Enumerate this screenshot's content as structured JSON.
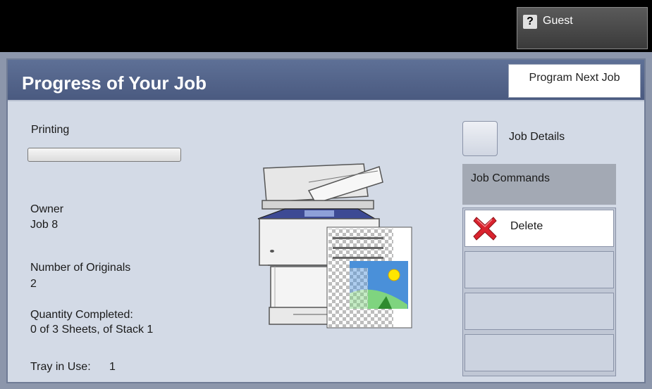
{
  "header": {
    "user_label": "Guest",
    "user_icon": "help-question-icon"
  },
  "page": {
    "title": "Progress of Your Job",
    "program_next_job_label": "Program Next Job"
  },
  "status": {
    "state_label": "Printing",
    "progress_fraction": 0.0
  },
  "job_info": {
    "owner_label": "Owner",
    "owner_value": "Job 8",
    "originals_label": "Number of Originals",
    "originals_value": "2",
    "quantity_label": "Quantity Completed:",
    "quantity_value": "0 of 3 Sheets, of Stack 1",
    "tray_label": "Tray in Use:",
    "tray_value": "1"
  },
  "actions": {
    "job_details_label": "Job Details",
    "job_commands_label": "Job Commands",
    "delete_label": "Delete",
    "delete_icon": "delete-x-icon"
  },
  "colors": {
    "title_bar": "#4f6096",
    "panel_bg": "#d3dae6",
    "delete_icon": "#d9232e"
  }
}
